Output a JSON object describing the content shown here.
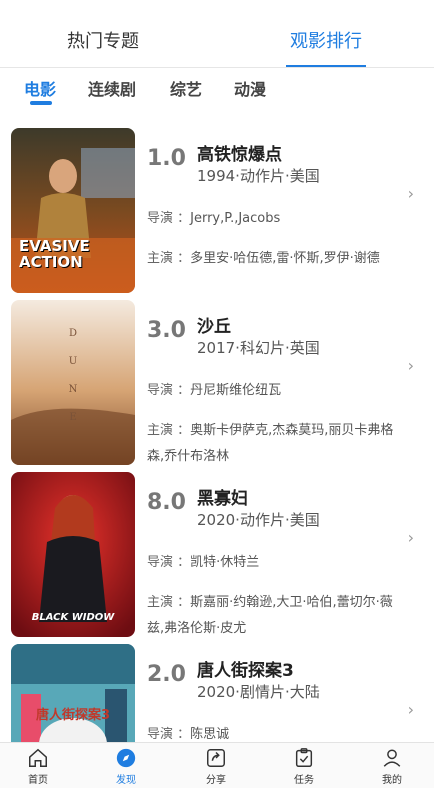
{
  "top_tabs": [
    {
      "label": "热门专题"
    },
    {
      "label": "观影排行"
    }
  ],
  "category_tabs": [
    {
      "label": "电影"
    },
    {
      "label": "连续剧"
    },
    {
      "label": "综艺"
    },
    {
      "label": "动漫"
    }
  ],
  "director_prefix": "导演 ：",
  "cast_prefix": "主演 ：",
  "movies": [
    {
      "score": "1.0",
      "title": "高铁惊爆点",
      "meta": "1994·动作片·美国",
      "director": "Jerry,P.,Jacobs",
      "cast": "多里安·哈伍德,雷·怀斯,罗伊·谢德",
      "poster_text": "EVASIVE ACTION"
    },
    {
      "score": "3.0",
      "title": "沙丘",
      "meta": "2017·科幻片·英国",
      "director": "丹尼斯维伦纽瓦",
      "cast": "奥斯卡伊萨克,杰森莫玛,丽贝卡弗格森,乔什布洛林",
      "poster_text": "DUNE"
    },
    {
      "score": "8.0",
      "title": "黑寡妇",
      "meta": "2020·动作片·美国",
      "director": "凯特·休特兰",
      "cast": "斯嘉丽·约翰逊,大卫·哈伯,蕾切尔·薇兹,弗洛伦斯·皮尤",
      "poster_text": "BLACK WIDOW"
    },
    {
      "score": "2.0",
      "title": "唐人街探案3",
      "meta": "2020·剧情片·大陆",
      "director": "陈思诚",
      "cast": "",
      "poster_text": "唐人街探案3"
    }
  ],
  "bottom_nav": [
    {
      "label": "首页",
      "icon": "home-icon"
    },
    {
      "label": "发现",
      "icon": "compass-icon"
    },
    {
      "label": "分享",
      "icon": "share-icon"
    },
    {
      "label": "任务",
      "icon": "task-icon"
    },
    {
      "label": "我的",
      "icon": "user-icon"
    }
  ],
  "colors": {
    "accent": "#1f7de0"
  }
}
